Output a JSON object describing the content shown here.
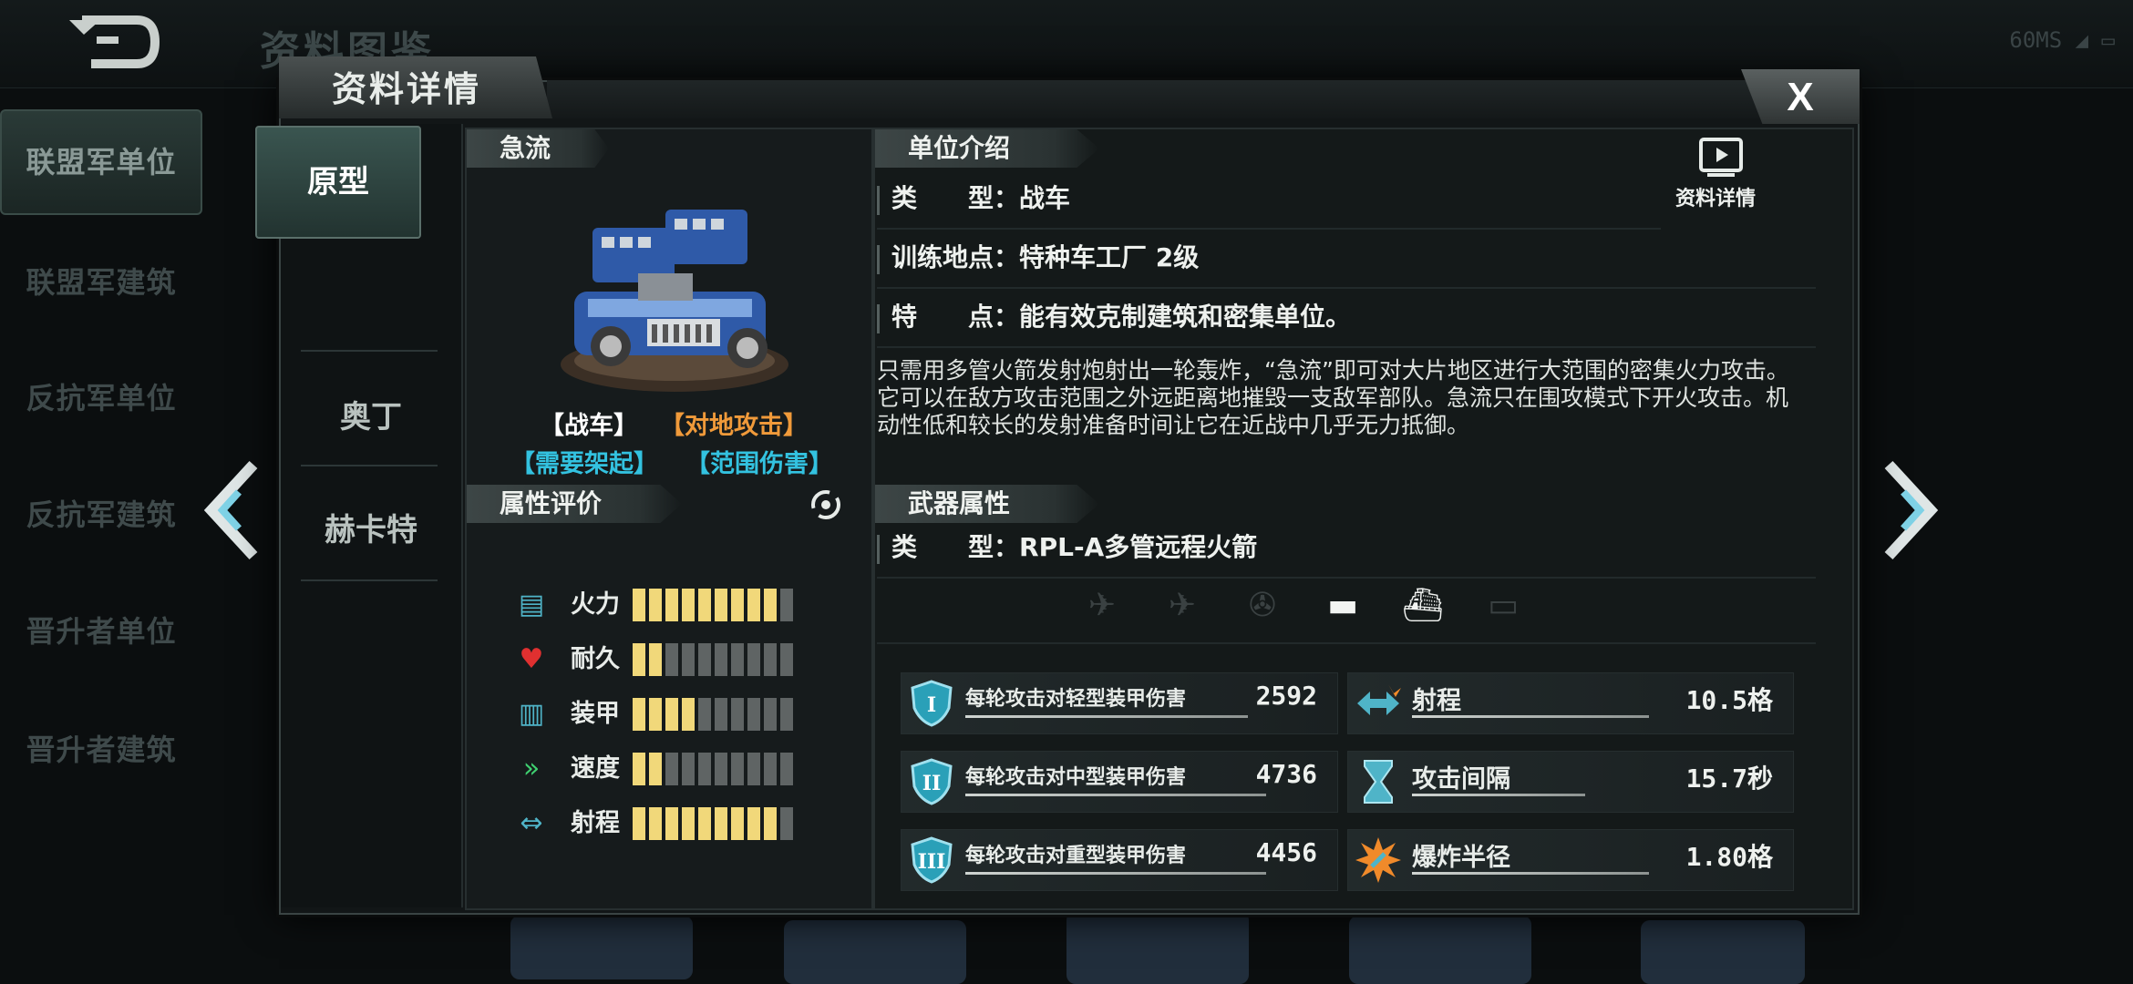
{
  "background": {
    "title": "资料图鉴",
    "status": "60MS",
    "sidebar": [
      "联盟军单位",
      "联盟军建筑",
      "反抗军单位",
      "反抗军建筑",
      "晋升者单位",
      "晋升者建筑"
    ]
  },
  "modal": {
    "title": "资料详情",
    "close": "X",
    "variants": [
      "原型",
      "奥丁",
      "赫卡特"
    ]
  },
  "unit": {
    "name": "急流",
    "tags": [
      {
        "text": "【战车】",
        "color": "#ffffff"
      },
      {
        "text": "【对地攻击】",
        "color": "#f09a3a"
      },
      {
        "text": "【需要架起】",
        "color": "#33c2e0"
      },
      {
        "text": "【范围伤害】",
        "color": "#33c2e0"
      }
    ]
  },
  "attributes": {
    "title": "属性评价",
    "items": [
      {
        "label": "火力",
        "level": 9,
        "max": 10,
        "icon": "firepower-icon"
      },
      {
        "label": "耐久",
        "level": 2,
        "max": 10,
        "icon": "heart-icon"
      },
      {
        "label": "装甲",
        "level": 4,
        "max": 10,
        "icon": "armor-icon"
      },
      {
        "label": "速度",
        "level": 2,
        "max": 10,
        "icon": "speed-icon"
      },
      {
        "label": "射程",
        "level": 9,
        "max": 10,
        "icon": "range-icon"
      }
    ]
  },
  "intro": {
    "title": "单位介绍",
    "video_label": "资料详情",
    "rows": [
      {
        "label": "类　　型：",
        "value": "战车"
      },
      {
        "label": "训练地点：",
        "value": "特种车工厂 2级"
      },
      {
        "label": "特　　点：",
        "value": "能有效克制建筑和密集单位。"
      }
    ],
    "description": "只需用多管火箭发射炮射出一轮轰炸，“急流”即可对大片地区进行大范围的密集火力攻击。它可以在敌方攻击范围之外远距离地摧毁一支敌军部队。急流只在围攻模式下开火攻击。机动性低和较长的发射准备时间让它在近战中几乎无力抵御。"
  },
  "weapon": {
    "title": "武器属性",
    "type_label": "类　　型：",
    "type_value": "RPL-A多管远程火箭",
    "targets": [
      {
        "icon": "fighter-jet-icon",
        "active": false
      },
      {
        "icon": "aircraft-icon",
        "active": false
      },
      {
        "icon": "helicopter-icon",
        "active": false
      },
      {
        "icon": "tank-icon",
        "active": true
      },
      {
        "icon": "ship-icon",
        "active": true
      },
      {
        "icon": "submarine-icon",
        "active": false
      }
    ],
    "damage": [
      {
        "label": "每轮攻击对轻型装甲伤害",
        "value": "2592",
        "tier": "I"
      },
      {
        "label": "每轮攻击对中型装甲伤害",
        "value": "4736",
        "tier": "II"
      },
      {
        "label": "每轮攻击对重型装甲伤害",
        "value": "4456",
        "tier": "III"
      }
    ],
    "stats": [
      {
        "label": "射程",
        "value": "10.5格",
        "icon": "range-icon"
      },
      {
        "label": "攻击间隔",
        "value": "15.7秒",
        "icon": "hourglass-icon"
      },
      {
        "label": "爆炸半径",
        "value": "1.80格",
        "icon": "explosion-icon"
      }
    ]
  },
  "colors": {
    "accent": "#f1d87a",
    "cyan": "#33c2e0",
    "orange": "#f09a3a"
  }
}
